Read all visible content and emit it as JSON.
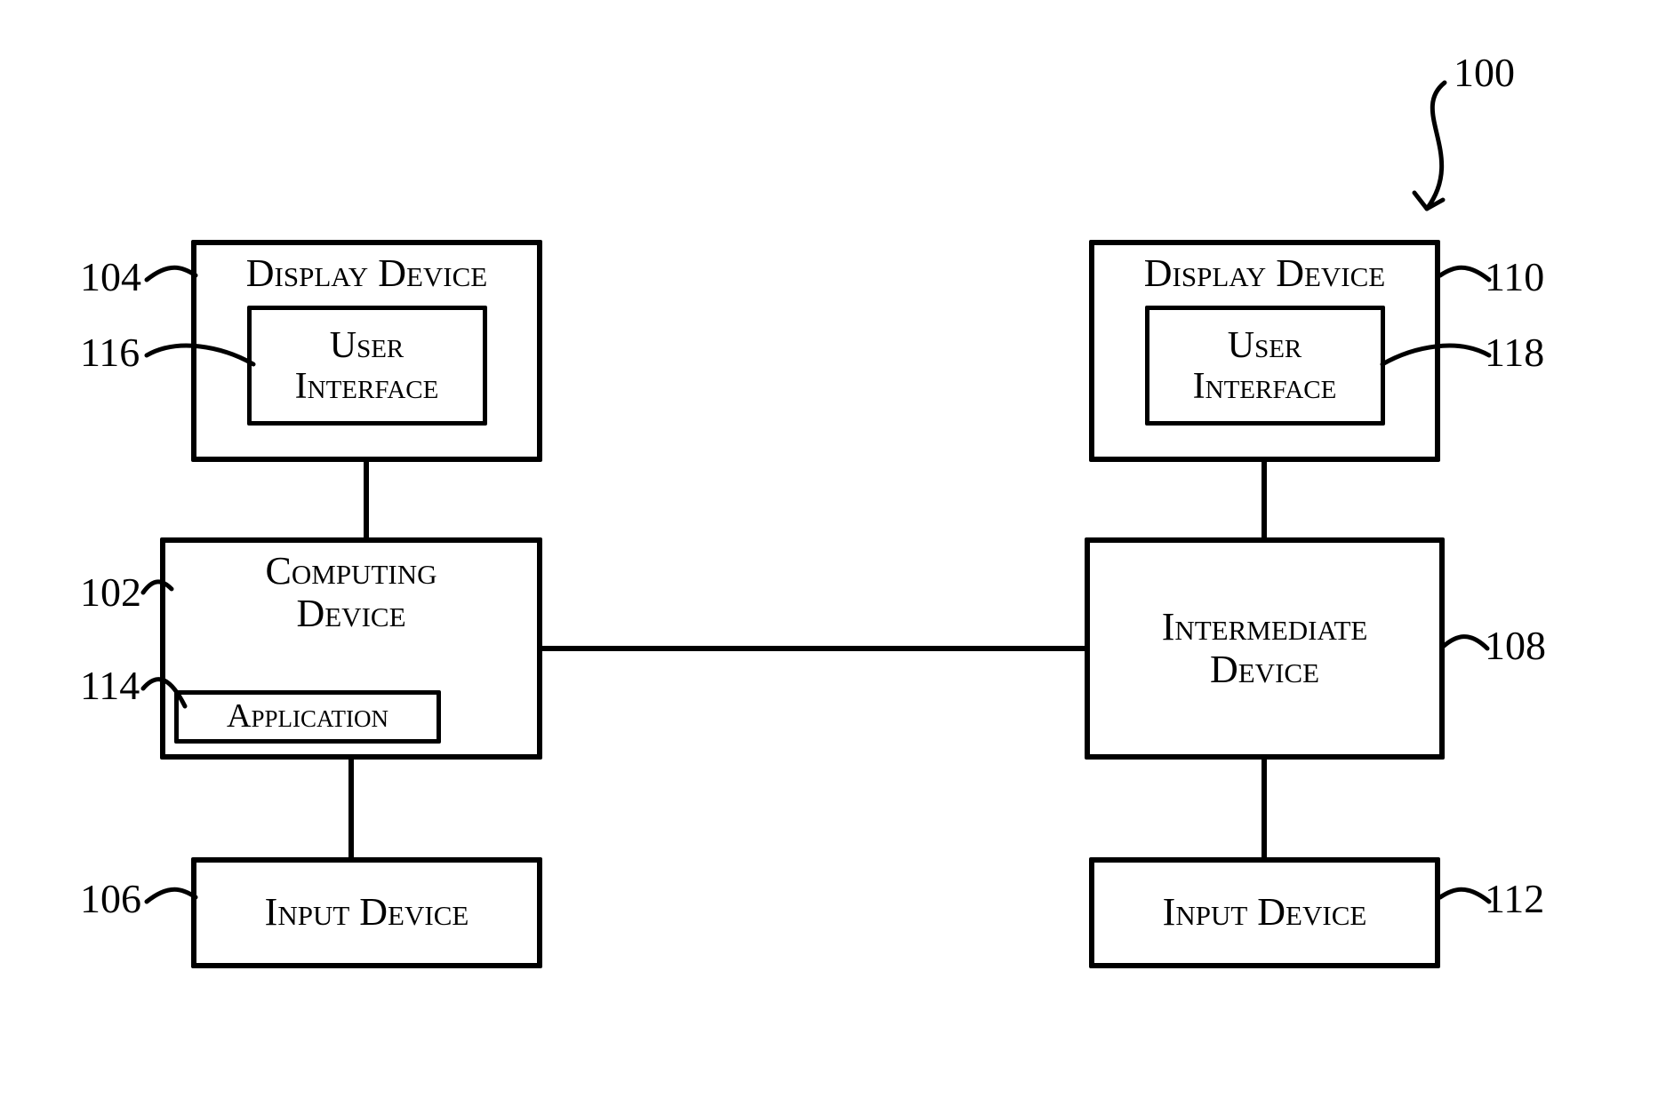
{
  "figure_ref": "100",
  "blocks": {
    "display_left": {
      "title": "Display Device",
      "inner_title": "User\nInterface"
    },
    "display_right": {
      "title": "Display Device",
      "inner_title": "User\nInterface"
    },
    "computing": {
      "title": "Computing\nDevice",
      "inner_title": "Application"
    },
    "intermediate": {
      "title": "Intermediate\nDevice"
    },
    "input_left": {
      "title": "Input Device"
    },
    "input_right": {
      "title": "Input Device"
    }
  },
  "refs": {
    "figure": "100",
    "display_left": "104",
    "ui_left": "116",
    "computing": "102",
    "application": "114",
    "input_left": "106",
    "display_right": "110",
    "ui_right": "118",
    "intermediate": "108",
    "input_right": "112"
  }
}
